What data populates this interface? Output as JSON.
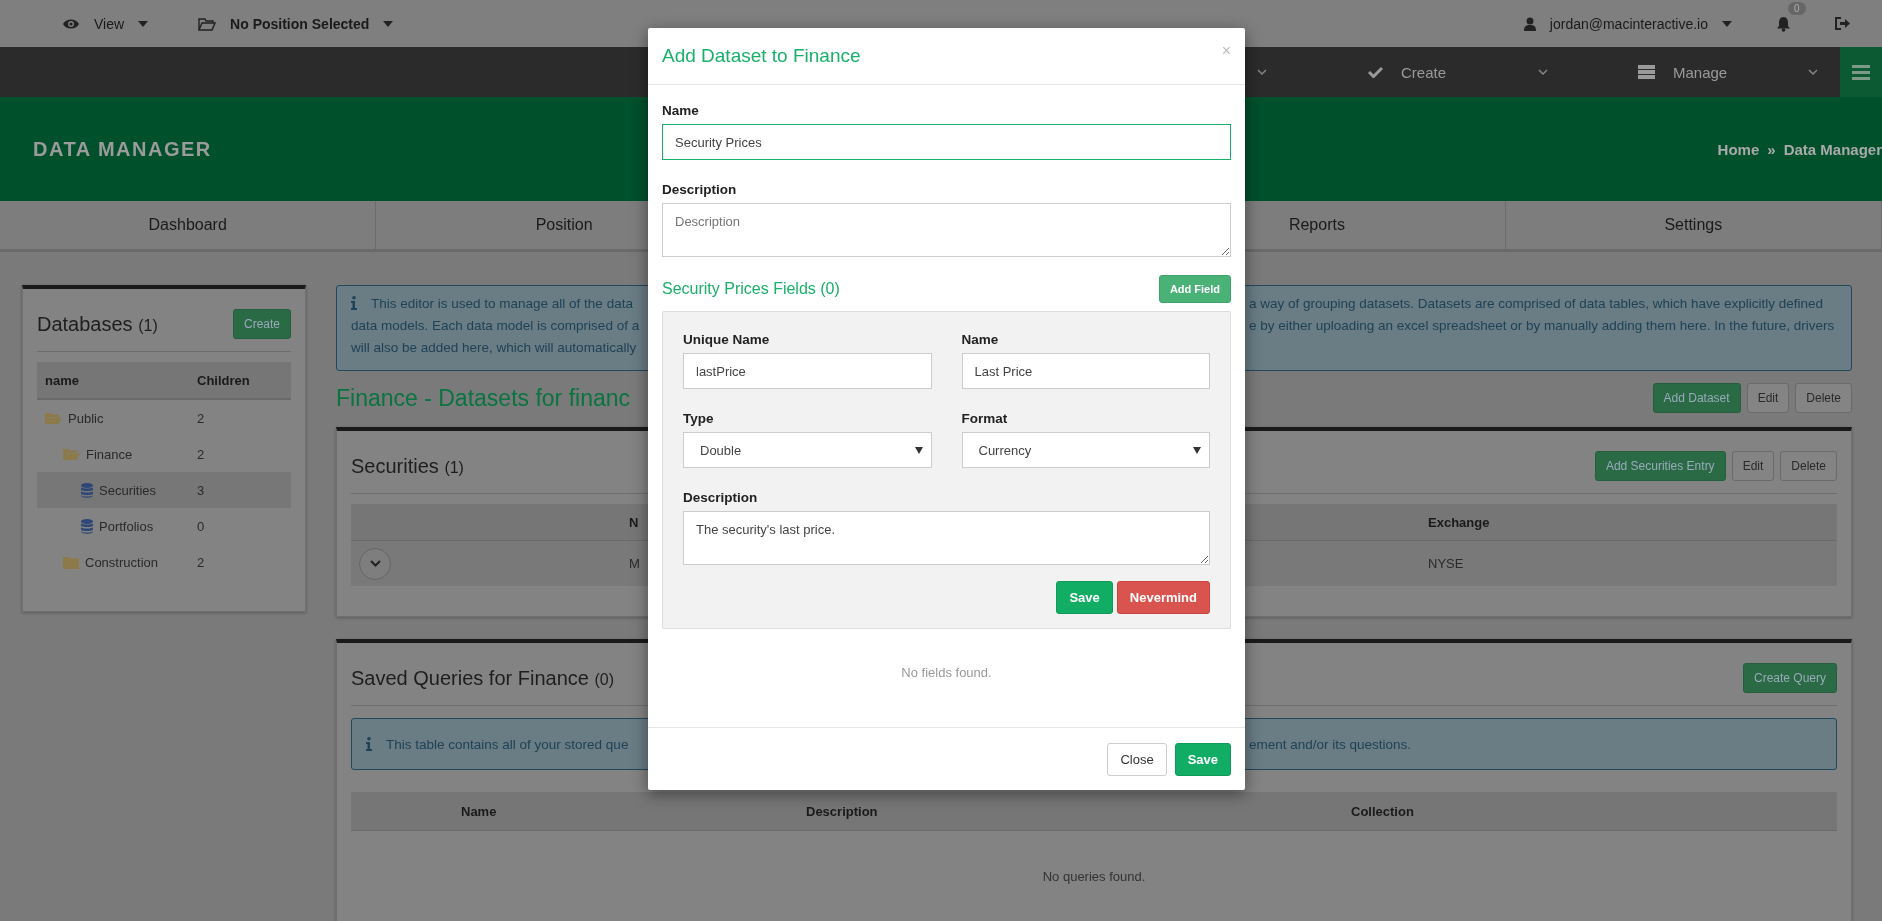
{
  "top_bar": {
    "view_menu": {
      "label": "View"
    },
    "position_menu": {
      "label": "No Position Selected"
    },
    "user_menu": {
      "label": "jordan@macinteractive.io"
    },
    "notifications": {
      "count": "0"
    }
  },
  "nav_bar": {
    "items": [
      {
        "label": "Create",
        "kind": "check"
      },
      {
        "label": "Manage",
        "kind": "server"
      }
    ]
  },
  "header": {
    "title": "DATA MANAGER",
    "breadcrumb": {
      "items": [
        "Home",
        "Data Manager"
      ],
      "separator": "»"
    }
  },
  "tabs": [
    {
      "label": "Dashboard"
    },
    {
      "label": "Position"
    },
    {
      "label": "Reports"
    },
    {
      "label": "Settings"
    }
  ],
  "databases_panel": {
    "title": "Databases",
    "count": "(1)",
    "create_button": "Create",
    "columns": [
      "name",
      "Children"
    ],
    "tree": [
      {
        "label": "Public",
        "count": "2",
        "kind": "folder",
        "expanded": true,
        "selected": false,
        "children": [
          {
            "label": "Finance",
            "count": "2",
            "kind": "folder",
            "expanded": true,
            "selected": false,
            "children": [
              {
                "label": "Securities",
                "count": "3",
                "kind": "database",
                "selected": true
              },
              {
                "label": "Portfolios",
                "count": "0",
                "kind": "database",
                "selected": false
              }
            ]
          },
          {
            "label": "Construction",
            "count": "2",
            "kind": "folder",
            "expanded": false,
            "selected": false
          }
        ]
      }
    ]
  },
  "info_box": {
    "lines_left": [
      "This editor is used to manage all of the data",
      "data models. Each data model is comprised of a",
      "will also be added here, which will automatically"
    ],
    "lines_right": [
      "a way of grouping datasets. Datasets are comprised of data tables, which have explicitly defined",
      "e by either uploading an excel spreadsheet or by manually adding them here. In the future, drivers"
    ]
  },
  "datasets_heading": "Finance - Datasets for financ",
  "dataset_buttons": [
    {
      "label": "Add Dataset",
      "kind": "primary"
    },
    {
      "label": "Edit",
      "kind": "default"
    },
    {
      "label": "Delete",
      "kind": "default"
    }
  ],
  "securities_panel": {
    "title": "Securities",
    "count": "(1)",
    "buttons": [
      {
        "label": "Add Securities Entry",
        "kind": "primary"
      },
      {
        "label": "Edit",
        "kind": "default"
      },
      {
        "label": "Delete",
        "kind": "default"
      }
    ],
    "columns": [
      "N",
      "Exchange"
    ],
    "rows": [
      {
        "cells": [
          "M",
          "NYSE"
        ]
      }
    ]
  },
  "saved_queries_panel": {
    "title": "Saved Queries for Finance",
    "count": "(0)",
    "button": "Create Query",
    "info_left": "This table contains all of your stored que",
    "info_right": "ement and/or its questions.",
    "columns": [
      "Name",
      "Description",
      "Collection"
    ],
    "empty_text": "No queries found."
  },
  "modal": {
    "title": "Add Dataset to Finance",
    "close": "×",
    "name_label": "Name",
    "name_value": "Security Prices",
    "description_label": "Description",
    "description_placeholder": "Description",
    "fields_heading": "Security Prices Fields (0)",
    "add_field_button": "Add Field",
    "field_form": {
      "unique_name_label": "Unique Name",
      "unique_name_value": "lastPrice",
      "name_label": "Name",
      "name_value": "Last Price",
      "type_label": "Type",
      "type_value": "Double",
      "format_label": "Format",
      "format_value": "Currency",
      "description_label": "Description",
      "description_value": "The security's last price.",
      "save_button": "Save",
      "cancel_button": "Nevermind"
    },
    "empty_text": "No fields found.",
    "footer_buttons": [
      {
        "label": "Close",
        "kind": "default"
      },
      {
        "label": "Save",
        "kind": "primary"
      }
    ]
  }
}
